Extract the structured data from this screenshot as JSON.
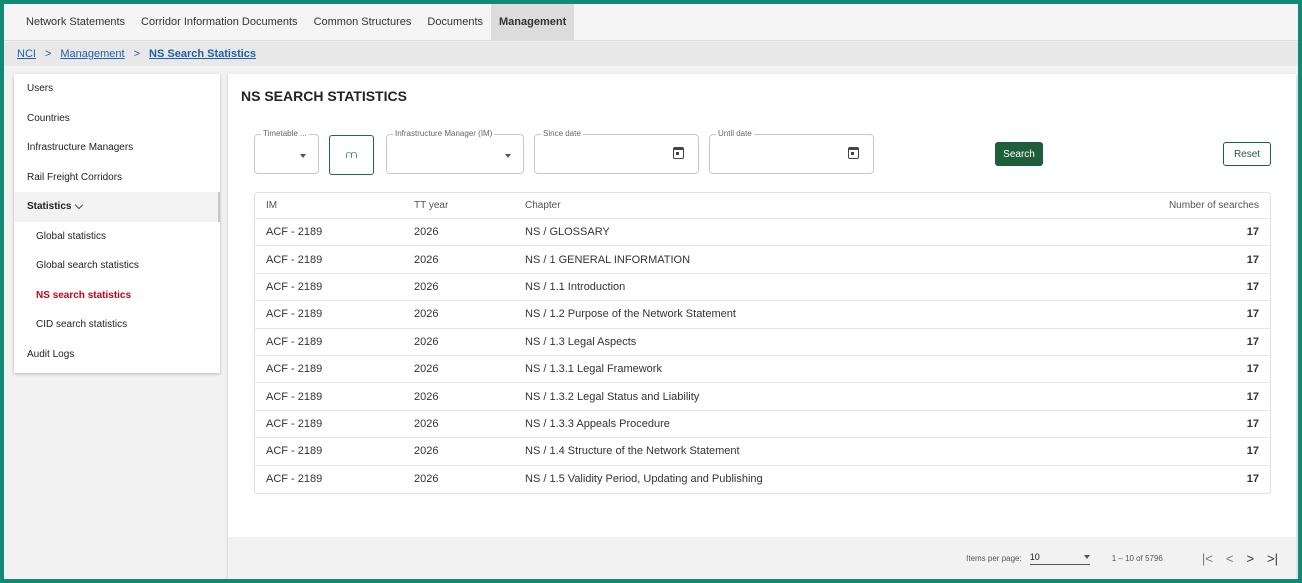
{
  "topnav": {
    "tabs": [
      {
        "label": "Network Statements",
        "active": false
      },
      {
        "label": "Corridor Information Documents",
        "active": false
      },
      {
        "label": "Common Structures",
        "active": false
      },
      {
        "label": "Documents",
        "active": false
      },
      {
        "label": "Management",
        "active": true
      }
    ]
  },
  "breadcrumb": {
    "items": [
      "NCI",
      "Management",
      "NS Search Statistics"
    ],
    "separator": ">"
  },
  "sidebar": {
    "items": [
      {
        "label": "Users"
      },
      {
        "label": "Countries"
      },
      {
        "label": "Infrastructure Managers"
      },
      {
        "label": "Rail Freight Corridors"
      },
      {
        "label": "Statistics"
      },
      {
        "label": "Global statistics"
      },
      {
        "label": "Global search statistics"
      },
      {
        "label": "NS search statistics"
      },
      {
        "label": "CID search statistics"
      },
      {
        "label": "Audit Logs"
      }
    ]
  },
  "main": {
    "title": "NS SEARCH STATISTICS",
    "filters": {
      "timetable_label": "Timetable ...",
      "im_label": "Infrastructure Manager (IM)",
      "since_label": "Since date",
      "until_label": "Until date"
    },
    "search_label": "Search",
    "reset_label": "Reset",
    "table": {
      "headers": [
        "IM",
        "TT year",
        "Chapter",
        "Number of searches"
      ],
      "rows": [
        [
          "ACF - 2189",
          "2026",
          "NS / GLOSSARY",
          "17"
        ],
        [
          "ACF - 2189",
          "2026",
          "NS / 1 GENERAL INFORMATION",
          "17"
        ],
        [
          "ACF - 2189",
          "2026",
          "NS / 1.1 Introduction",
          "17"
        ],
        [
          "ACF - 2189",
          "2026",
          "NS / 1.2 Purpose of the Network Statement",
          "17"
        ],
        [
          "ACF - 2189",
          "2026",
          "NS / 1.3 Legal Aspects",
          "17"
        ],
        [
          "ACF - 2189",
          "2026",
          "NS / 1.3.1 Legal Framework",
          "17"
        ],
        [
          "ACF - 2189",
          "2026",
          "NS / 1.3.2 Legal Status and Liability",
          "17"
        ],
        [
          "ACF - 2189",
          "2026",
          "NS / 1.3.3 Appeals Procedure",
          "17"
        ],
        [
          "ACF - 2189",
          "2026",
          "NS / 1.4 Structure of the Network Statement",
          "17"
        ],
        [
          "ACF - 2189",
          "2026",
          "NS / 1.5 Validity Period, Updating and Publishing",
          "17"
        ]
      ]
    },
    "paginator": {
      "items_per_page_label": "Items per page:",
      "page_size": "10",
      "range": "1 – 10 of 5796"
    }
  },
  "colors": {
    "frame": "#0f8a74",
    "accent": "#1e5e3a",
    "active_nav": "#c6001b",
    "link": "#1f5fa8"
  }
}
